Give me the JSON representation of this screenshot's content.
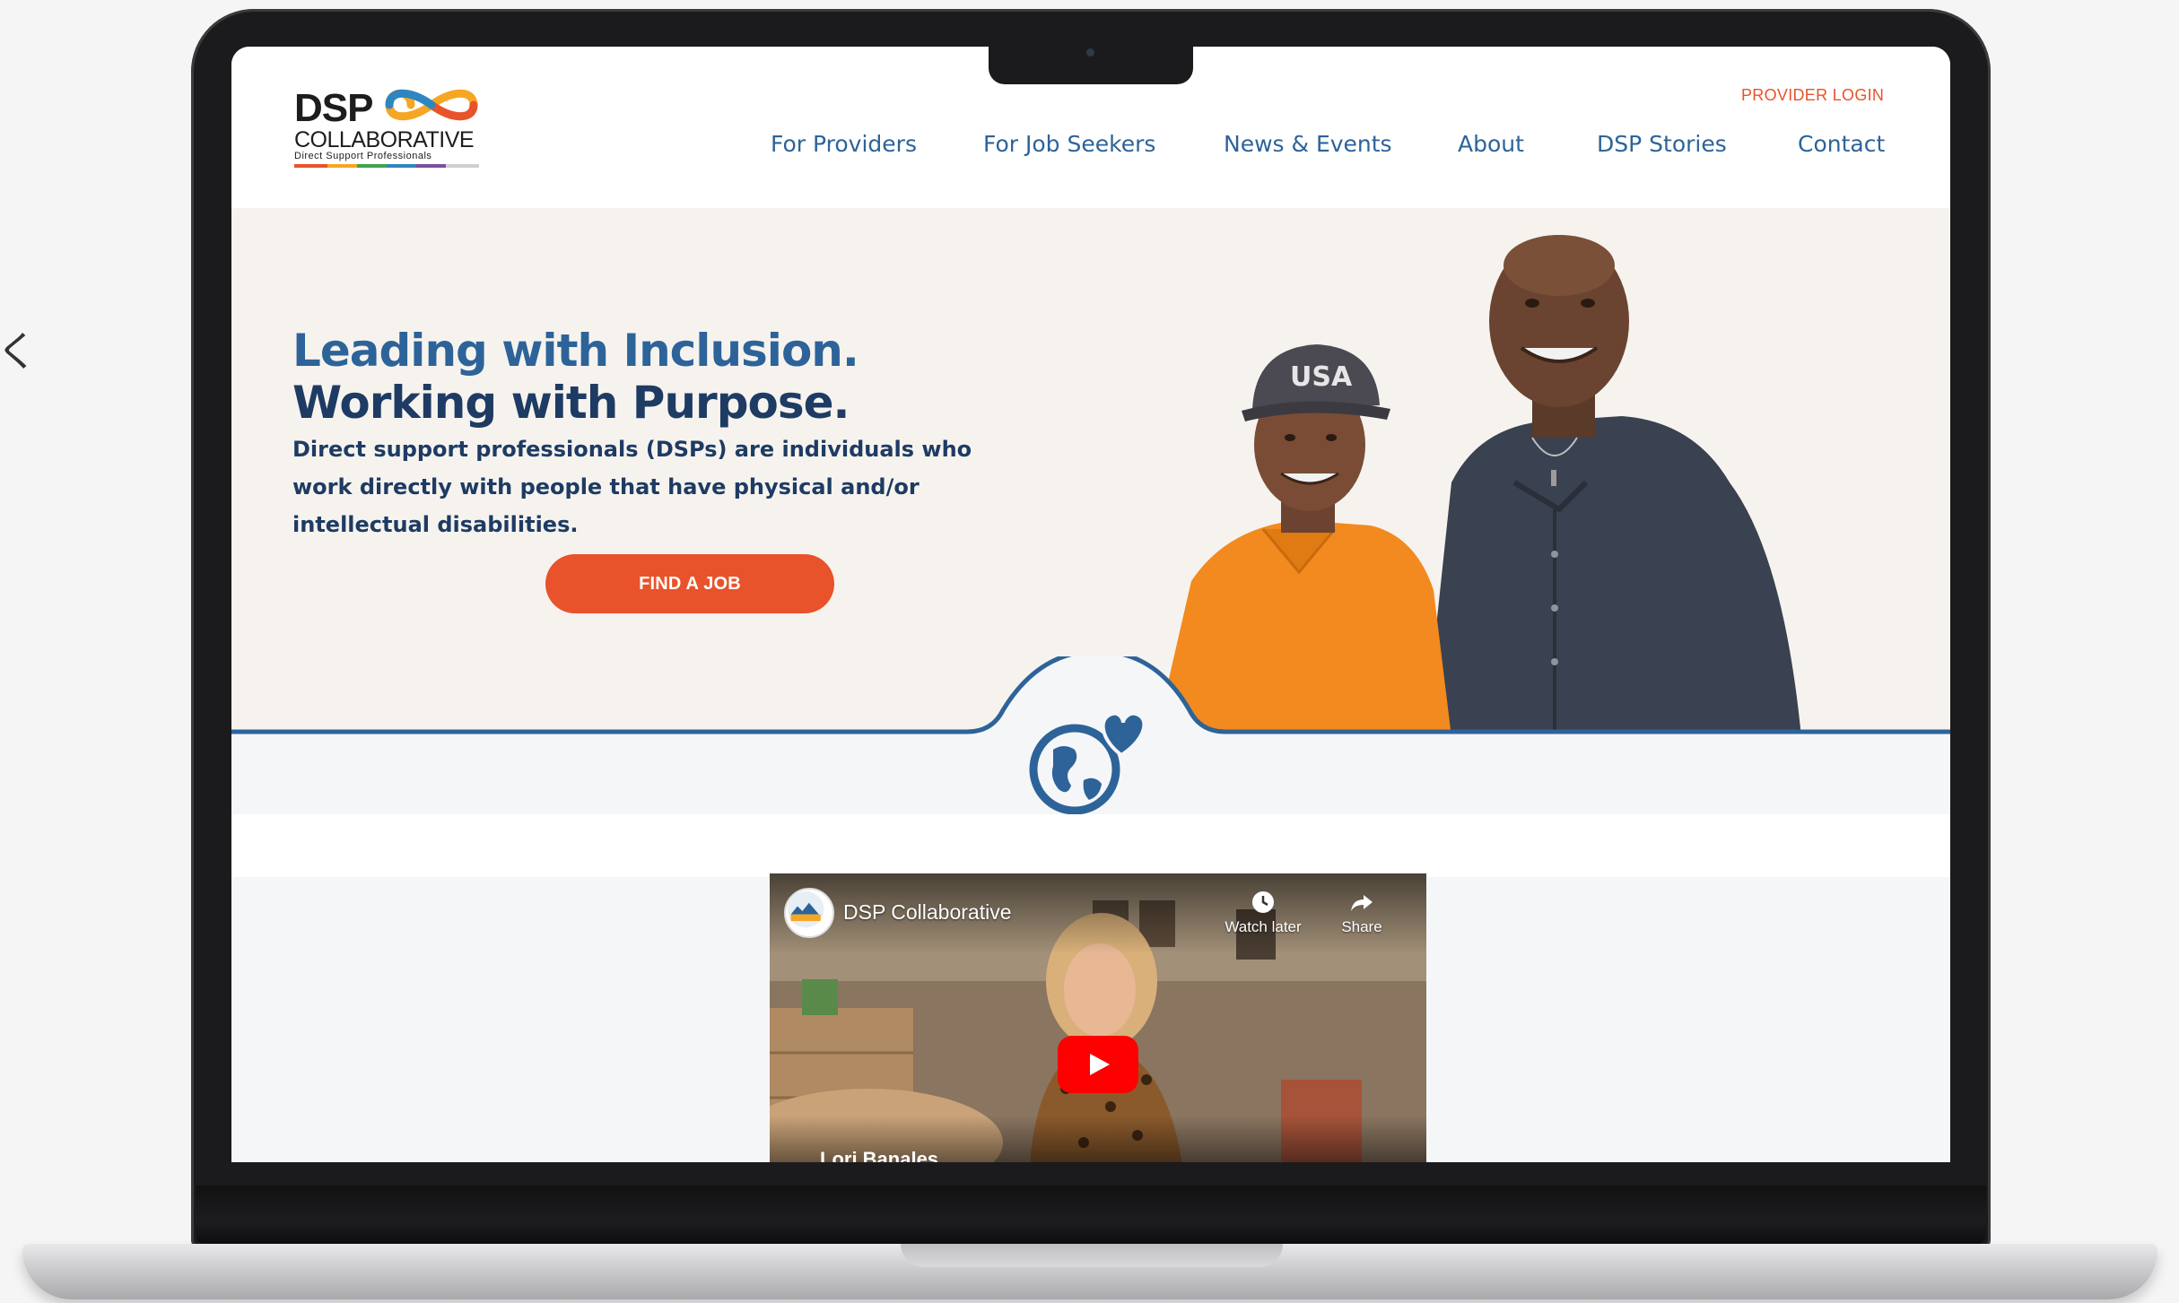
{
  "site": {
    "logo": {
      "wordmark": "DSP",
      "wordmark_line2": "COLLABORATIVE",
      "tagline": "Direct Support Professionals"
    },
    "provider_login": "PROVIDER LOGIN",
    "nav": [
      {
        "label": "For Providers"
      },
      {
        "label": "For Job Seekers"
      },
      {
        "label": "News & Events"
      },
      {
        "label": "About"
      },
      {
        "label": "DSP Stories"
      },
      {
        "label": "Contact"
      }
    ]
  },
  "hero": {
    "headline_line1": "Leading with Inclusion.",
    "headline_line2": "Working with Purpose.",
    "body": "Direct support professionals (DSPs) are individuals who work directly with people that have physical and/or intellectual disabilities.",
    "cta_label": "FIND A JOB",
    "photo_caps_text": "USA"
  },
  "video": {
    "channel_title": "DSP Collaborative",
    "watch_later": "Watch later",
    "share": "Share",
    "lower_third_name": "Lori Banales"
  },
  "colors": {
    "brand_blue": "#2d6399",
    "navy": "#1e3b64",
    "accent_orange": "#e8532b",
    "hero_bg": "#f6f3ee",
    "youtube_red": "#ff0000"
  },
  "icons": [
    "infinity-logo-icon",
    "globe-heart-icon",
    "play-icon",
    "clock-icon",
    "share-arrow-icon"
  ],
  "device": {
    "edge_glyph": "く"
  }
}
